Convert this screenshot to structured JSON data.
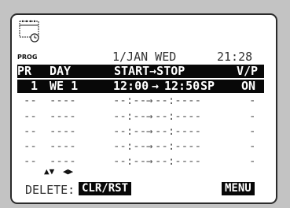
{
  "header": {
    "icon_label": "PROG",
    "date": "1/JAN WED",
    "time": "21:28"
  },
  "columns": {
    "pr": "PR",
    "day": "DAY",
    "start_stop": "START→STOP",
    "vp": "V/P"
  },
  "programs": [
    {
      "pr": "1",
      "day": "WE 1",
      "start": "12:00",
      "arrow": "→",
      "stop": "12:50",
      "speed": "SP",
      "vp": "ON"
    },
    {
      "pr": "--",
      "day": "----",
      "start": "--:--",
      "arrow": "→",
      "stop": "--:----",
      "speed": "",
      "vp": "-"
    },
    {
      "pr": "--",
      "day": "----",
      "start": "--:--",
      "arrow": "→",
      "stop": "--:----",
      "speed": "",
      "vp": "-"
    },
    {
      "pr": "--",
      "day": "----",
      "start": "--:--",
      "arrow": "→",
      "stop": "--:----",
      "speed": "",
      "vp": "-"
    },
    {
      "pr": "--",
      "day": "----",
      "start": "--:--",
      "arrow": "→",
      "stop": "--:----",
      "speed": "",
      "vp": "-"
    },
    {
      "pr": "--",
      "day": "----",
      "start": "--:--",
      "arrow": "→",
      "stop": "--:----",
      "speed": "",
      "vp": "-"
    }
  ],
  "footer": {
    "nav_updown": "▲▼",
    "nav_leftright": "◀▶",
    "delete_label": "DELETE:",
    "clr_key": "CLR/RST",
    "menu_key": "MENU"
  },
  "colors": {
    "background": "#c3c3c3",
    "panel": "#ffffff",
    "highlight": "#080808"
  }
}
